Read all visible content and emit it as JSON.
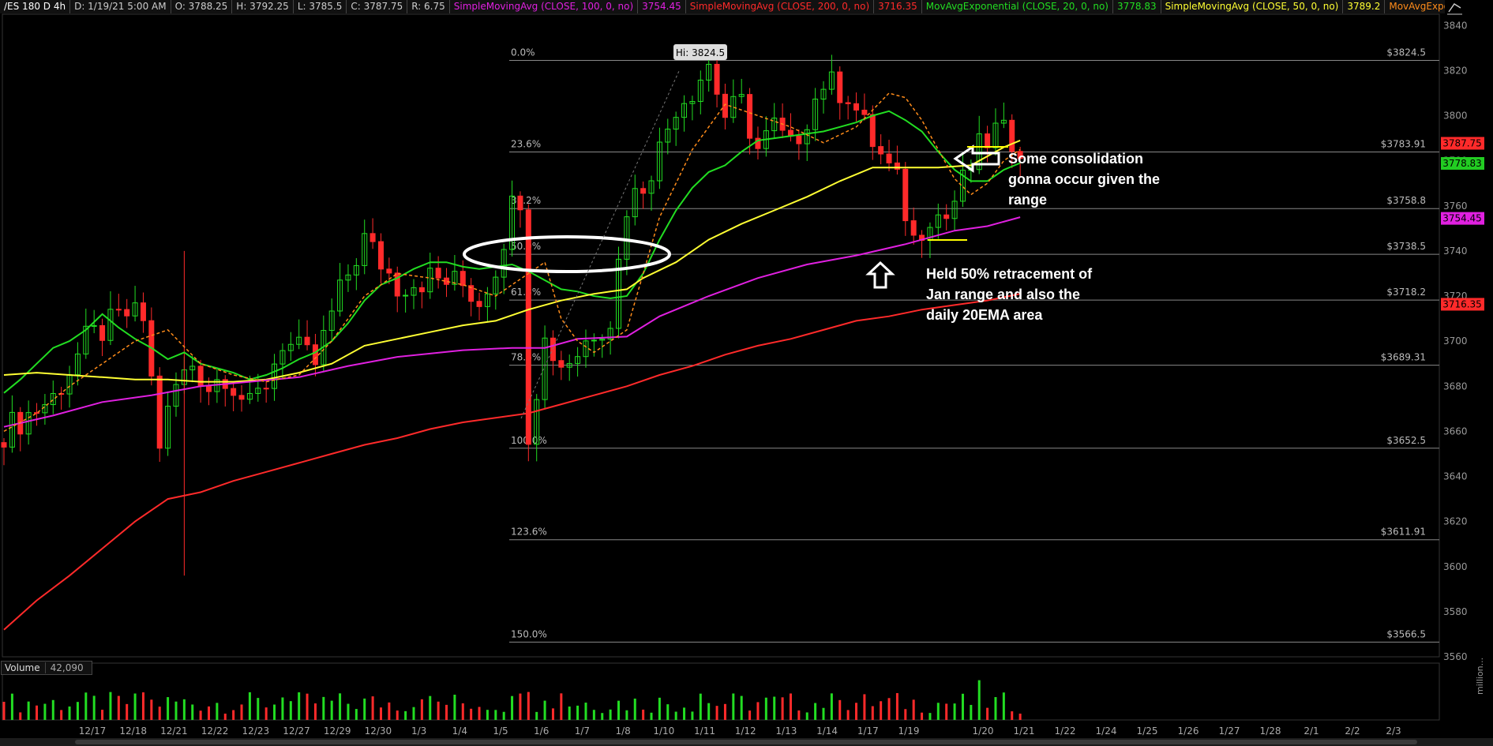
{
  "header": {
    "symbol": "/ES 180 D 4h",
    "date": "D: 1/19/21 5:00 AM",
    "open": "O: 3788.25",
    "high": "H: 3792.25",
    "low": "L: 3785.5",
    "close": "C: 3787.75",
    "range": "R: 6.75",
    "studies": [
      {
        "label": "SimpleMovingAvg (CLOSE, 100, 0, no)",
        "value": "3754.45",
        "color": "#e020e0"
      },
      {
        "label": "SimpleMovingAvg (CLOSE, 200, 0, no)",
        "value": "3716.35",
        "color": "#ff2a2a"
      },
      {
        "label": "MovAvgExponential (CLOSE, 20, 0, no)",
        "value": "3778.83",
        "color": "#22dd22"
      },
      {
        "label": "SimpleMovingAvg (CLOSE, 50, 0, no)",
        "value": "3789.2",
        "color": "#ffff33"
      },
      {
        "label": "MovAvgExponential ...",
        "value": "",
        "color": "#ff8c1a"
      }
    ]
  },
  "annotations": {
    "consolidation": [
      "Some consolidation",
      "gonna occur given the",
      "range"
    ],
    "retracement": [
      "Held 50% retracement of",
      "Jan range and also the",
      "daily 20EMA area"
    ],
    "high_callout": "Hi: 3824.5"
  },
  "volume": {
    "label": "Volume",
    "value": "42,090",
    "unit": "million..."
  },
  "chart_data": {
    "type": "candlestick",
    "ylim": [
      3560,
      3845
    ],
    "y_ticks": [
      3560,
      3580,
      3600,
      3620,
      3640,
      3660,
      3680,
      3700,
      3720,
      3740,
      3760,
      3780,
      3800,
      3820,
      3840
    ],
    "x_tick_labels": [
      "12/17",
      "12/18",
      "12/21",
      "12/22",
      "12/23",
      "12/27",
      "12/29",
      "12/30",
      "1/3",
      "1/4",
      "1/5",
      "1/6",
      "1/7",
      "1/8",
      "1/10",
      "1/11",
      "1/12",
      "1/13",
      "1/14",
      "1/17",
      "1/19",
      "1/20",
      "1/21",
      "1/22",
      "1/24",
      "1/25",
      "1/26",
      "1/27",
      "1/28",
      "2/1",
      "2/2",
      "2/3"
    ],
    "fib_levels": [
      {
        "pct": "0.0%",
        "price": 3824.5,
        "label": "$3824.5"
      },
      {
        "pct": "23.6%",
        "price": 3783.91,
        "label": "$3783.91"
      },
      {
        "pct": "38.2%",
        "price": 3758.8,
        "label": "$3758.8"
      },
      {
        "pct": "50.0%",
        "price": 3738.5,
        "label": "$3738.5"
      },
      {
        "pct": "61.8%",
        "price": 3718.2,
        "label": "$3718.2"
      },
      {
        "pct": "78.6%",
        "price": 3689.31,
        "label": "$3689.31"
      },
      {
        "pct": "100.0%",
        "price": 3652.5,
        "label": "$3652.5"
      },
      {
        "pct": "123.6%",
        "price": 3611.91,
        "label": "$3611.91"
      },
      {
        "pct": "150.0%",
        "price": 3566.5,
        "label": "$3566.5"
      }
    ],
    "price_tags": [
      {
        "value": "3787.75",
        "price": 3787.75,
        "color": "#ff2a2a"
      },
      {
        "value": "3778.83",
        "price": 3778.83,
        "color": "#22cc22"
      },
      {
        "value": "3754.45",
        "price": 3754.45,
        "color": "#e020e0"
      },
      {
        "value": "3716.35",
        "price": 3716.35,
        "color": "#ff2a2a"
      }
    ],
    "series": [
      {
        "name": "MovAvgExponential (CLOSE, 20, 0, no)",
        "color": "#22dd22",
        "points": [
          [
            0,
            3677
          ],
          [
            2,
            3683
          ],
          [
            4,
            3690
          ],
          [
            6,
            3697
          ],
          [
            8,
            3700
          ],
          [
            10,
            3705
          ],
          [
            12,
            3712
          ],
          [
            14,
            3706
          ],
          [
            16,
            3701
          ],
          [
            18,
            3697
          ],
          [
            20,
            3692
          ],
          [
            22,
            3695
          ],
          [
            24,
            3690
          ],
          [
            26,
            3688
          ],
          [
            28,
            3686
          ],
          [
            30,
            3683
          ],
          [
            32,
            3685
          ],
          [
            34,
            3688
          ],
          [
            36,
            3692
          ],
          [
            38,
            3695
          ],
          [
            40,
            3700
          ],
          [
            42,
            3708
          ],
          [
            44,
            3718
          ],
          [
            46,
            3725
          ],
          [
            48,
            3728
          ],
          [
            50,
            3732
          ],
          [
            52,
            3735
          ],
          [
            54,
            3735
          ],
          [
            56,
            3733
          ],
          [
            58,
            3732
          ],
          [
            60,
            3733
          ],
          [
            62,
            3734
          ],
          [
            64,
            3731
          ],
          [
            66,
            3727
          ],
          [
            68,
            3723
          ],
          [
            70,
            3722
          ],
          [
            72,
            3720
          ],
          [
            74,
            3719
          ],
          [
            76,
            3720
          ],
          [
            78,
            3730
          ],
          [
            80,
            3745
          ],
          [
            82,
            3758
          ],
          [
            84,
            3768
          ],
          [
            86,
            3775
          ],
          [
            88,
            3778
          ],
          [
            90,
            3784
          ],
          [
            92,
            3789
          ],
          [
            94,
            3790
          ],
          [
            96,
            3791
          ],
          [
            98,
            3792
          ],
          [
            100,
            3793
          ],
          [
            102,
            3795
          ],
          [
            104,
            3797
          ],
          [
            106,
            3800
          ],
          [
            108,
            3802
          ],
          [
            110,
            3798
          ],
          [
            112,
            3793
          ],
          [
            114,
            3784
          ],
          [
            116,
            3776
          ],
          [
            118,
            3771
          ],
          [
            120,
            3771
          ],
          [
            122,
            3776
          ],
          [
            124,
            3779
          ]
        ]
      },
      {
        "name": "SimpleMovingAvg (CLOSE, 50, 0, no)",
        "color": "#ffff33",
        "points": [
          [
            0,
            3685
          ],
          [
            4,
            3686
          ],
          [
            8,
            3685
          ],
          [
            12,
            3684
          ],
          [
            16,
            3683
          ],
          [
            20,
            3683
          ],
          [
            24,
            3682
          ],
          [
            28,
            3682
          ],
          [
            32,
            3683
          ],
          [
            36,
            3686
          ],
          [
            40,
            3690
          ],
          [
            44,
            3698
          ],
          [
            48,
            3701
          ],
          [
            52,
            3704
          ],
          [
            56,
            3707
          ],
          [
            60,
            3709
          ],
          [
            64,
            3714
          ],
          [
            68,
            3718
          ],
          [
            72,
            3721
          ],
          [
            74,
            3722
          ],
          [
            76,
            3723
          ],
          [
            78,
            3728
          ],
          [
            82,
            3735
          ],
          [
            86,
            3745
          ],
          [
            90,
            3752
          ],
          [
            94,
            3758
          ],
          [
            98,
            3764
          ],
          [
            102,
            3771
          ],
          [
            106,
            3777
          ],
          [
            110,
            3777
          ],
          [
            114,
            3777
          ],
          [
            118,
            3778
          ],
          [
            122,
            3786
          ],
          [
            124,
            3789
          ]
        ]
      },
      {
        "name": "SimpleMovingAvg (CLOSE, 100, 0, no)",
        "color": "#e020e0",
        "points": [
          [
            0,
            3662
          ],
          [
            6,
            3667
          ],
          [
            12,
            3673
          ],
          [
            18,
            3676
          ],
          [
            24,
            3680
          ],
          [
            30,
            3682
          ],
          [
            36,
            3684
          ],
          [
            42,
            3689
          ],
          [
            48,
            3693
          ],
          [
            56,
            3696
          ],
          [
            62,
            3697
          ],
          [
            66,
            3697
          ],
          [
            70,
            3701
          ],
          [
            76,
            3702
          ],
          [
            80,
            3711
          ],
          [
            86,
            3720
          ],
          [
            92,
            3728
          ],
          [
            98,
            3734
          ],
          [
            104,
            3738
          ],
          [
            110,
            3743
          ],
          [
            116,
            3749
          ],
          [
            120,
            3751
          ],
          [
            124,
            3755
          ]
        ]
      },
      {
        "name": "SimpleMovingAvg (CLOSE, 200, 0, no)",
        "color": "#ff2a2a",
        "points": [
          [
            0,
            3572
          ],
          [
            4,
            3585
          ],
          [
            8,
            3596
          ],
          [
            12,
            3608
          ],
          [
            16,
            3620
          ],
          [
            20,
            3630
          ],
          [
            24,
            3633
          ],
          [
            28,
            3638
          ],
          [
            32,
            3642
          ],
          [
            36,
            3646
          ],
          [
            40,
            3650
          ],
          [
            44,
            3654
          ],
          [
            48,
            3657
          ],
          [
            52,
            3661
          ],
          [
            56,
            3664
          ],
          [
            60,
            3666
          ],
          [
            64,
            3668
          ],
          [
            68,
            3672
          ],
          [
            72,
            3676
          ],
          [
            76,
            3680
          ],
          [
            80,
            3685
          ],
          [
            84,
            3689
          ],
          [
            88,
            3694
          ],
          [
            92,
            3698
          ],
          [
            96,
            3701
          ],
          [
            100,
            3705
          ],
          [
            104,
            3709
          ],
          [
            108,
            3711
          ],
          [
            112,
            3714
          ],
          [
            116,
            3716
          ],
          [
            120,
            3718
          ],
          [
            124,
            3721
          ]
        ]
      },
      {
        "name": "MovAvgExponential ...",
        "color": "#ff8c1a",
        "dashed": true,
        "points": [
          [
            0,
            3660
          ],
          [
            4,
            3668
          ],
          [
            8,
            3680
          ],
          [
            12,
            3690
          ],
          [
            16,
            3700
          ],
          [
            20,
            3705
          ],
          [
            24,
            3690
          ],
          [
            28,
            3685
          ],
          [
            32,
            3682
          ],
          [
            36,
            3685
          ],
          [
            40,
            3700
          ],
          [
            44,
            3720
          ],
          [
            48,
            3730
          ],
          [
            52,
            3728
          ],
          [
            56,
            3725
          ],
          [
            60,
            3720
          ],
          [
            64,
            3730
          ],
          [
            66,
            3735
          ],
          [
            68,
            3710
          ],
          [
            70,
            3700
          ],
          [
            72,
            3695
          ],
          [
            76,
            3705
          ],
          [
            80,
            3755
          ],
          [
            84,
            3785
          ],
          [
            88,
            3805
          ],
          [
            92,
            3800
          ],
          [
            96,
            3795
          ],
          [
            100,
            3788
          ],
          [
            104,
            3795
          ],
          [
            108,
            3810
          ],
          [
            110,
            3808
          ],
          [
            112,
            3798
          ],
          [
            114,
            3785
          ],
          [
            116,
            3772
          ],
          [
            118,
            3765
          ],
          [
            120,
            3770
          ],
          [
            122,
            3780
          ],
          [
            124,
            3785
          ]
        ]
      }
    ],
    "volume_bars": {
      "ylim": [
        0,
        1.3
      ],
      "color_up": "#22dd22",
      "color_down": "#ff2a2a"
    }
  }
}
